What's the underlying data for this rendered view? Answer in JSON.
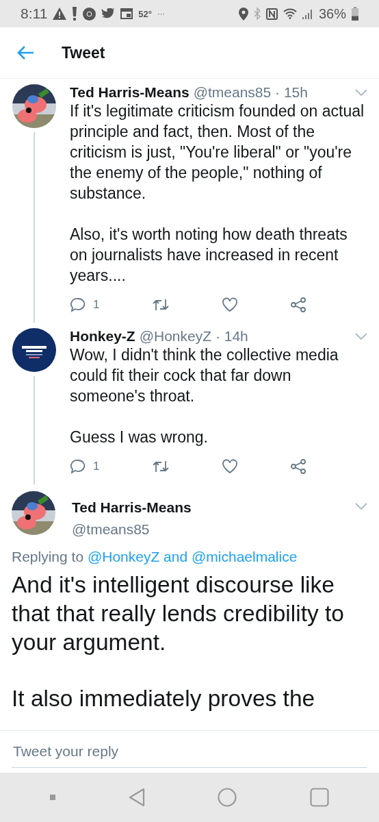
{
  "status_bar": {
    "time": "8:11",
    "temperature": "52°",
    "more": "···",
    "battery": "36%"
  },
  "header": {
    "title": "Tweet"
  },
  "replies": [
    {
      "name": "Ted Harris-Means",
      "handle": "@tmeans85",
      "separator": "·",
      "time": "15h",
      "paragraphs": [
        "If it's legitimate criticism founded on actual principle and fact, then. Most of the criticism is just, \"You're liberal\" or \"you're the enemy of the people,\" nothing of substance.",
        "Also, it's worth noting how death threats on journalists have increased in recent years...."
      ],
      "reply_count": "1"
    },
    {
      "name": "Honkey-Z",
      "handle": "@HonkeyZ",
      "separator": "·",
      "time": "14h",
      "paragraphs": [
        "Wow, I didn't think the collective media could fit their cock that far down someone's throat.",
        "Guess I was wrong."
      ],
      "reply_count": "1"
    }
  ],
  "main_tweet": {
    "name": "Ted Harris-Means",
    "handle": "@tmeans85",
    "replying_prefix": "Replying to",
    "mentions": [
      "@HonkeyZ",
      "@michaelmalice"
    ],
    "mention_joiner": "and",
    "paragraphs": [
      "And it's intelligent discourse like that that really lends credibility to your argument.",
      "It also immediately proves the"
    ]
  },
  "reply_field": {
    "placeholder": "Tweet your reply"
  }
}
